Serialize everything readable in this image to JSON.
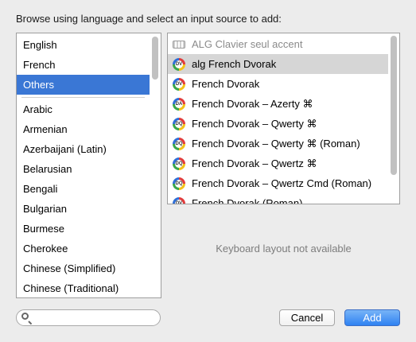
{
  "instruction": "Browse using language and select an input source to add:",
  "languages": {
    "top": [
      "English",
      "French",
      "Others"
    ],
    "selected": "Others",
    "rest": [
      "Arabic",
      "Armenian",
      "Azerbaijani (Latin)",
      "Belarusian",
      "Bengali",
      "Bulgarian",
      "Burmese",
      "Cherokee",
      "Chinese (Simplified)",
      "Chinese (Traditional)"
    ]
  },
  "sources": [
    {
      "label": "ALG Clavier seul accent",
      "icon": "keyboard-icon",
      "state": "disabled"
    },
    {
      "label": "alg French Dvorak",
      "icon": "dvorak-flag-icon",
      "state": "highlighted"
    },
    {
      "label": "French Dvorak",
      "icon": "dvorak-flag-icon",
      "state": "normal"
    },
    {
      "label": "French Dvorak – Azerty ⌘",
      "icon": "dvorak-flag-icon",
      "state": "normal"
    },
    {
      "label": "French Dvorak – Qwerty ⌘",
      "icon": "dvorak-flag-icon",
      "state": "normal"
    },
    {
      "label": "French Dvorak – Qwerty ⌘ (Roman)",
      "icon": "dvorak-flag-icon",
      "state": "normal"
    },
    {
      "label": "French Dvorak – Qwertz ⌘",
      "icon": "dvorak-flag-icon",
      "state": "normal"
    },
    {
      "label": "French Dvorak – Qwertz Cmd (Roman)",
      "icon": "dvorak-flag-icon",
      "state": "normal"
    },
    {
      "label": "French Dvorak (Roman)",
      "icon": "dvorak-flag-icon",
      "state": "normal"
    }
  ],
  "unavailable_text": "Keyboard layout not available",
  "search": {
    "placeholder": "",
    "value": ""
  },
  "buttons": {
    "cancel": "Cancel",
    "add": "Add"
  },
  "colors": {
    "selection": "#3a77d5",
    "highlight": "#d6d6d6",
    "default_button": "#2f82f2"
  }
}
